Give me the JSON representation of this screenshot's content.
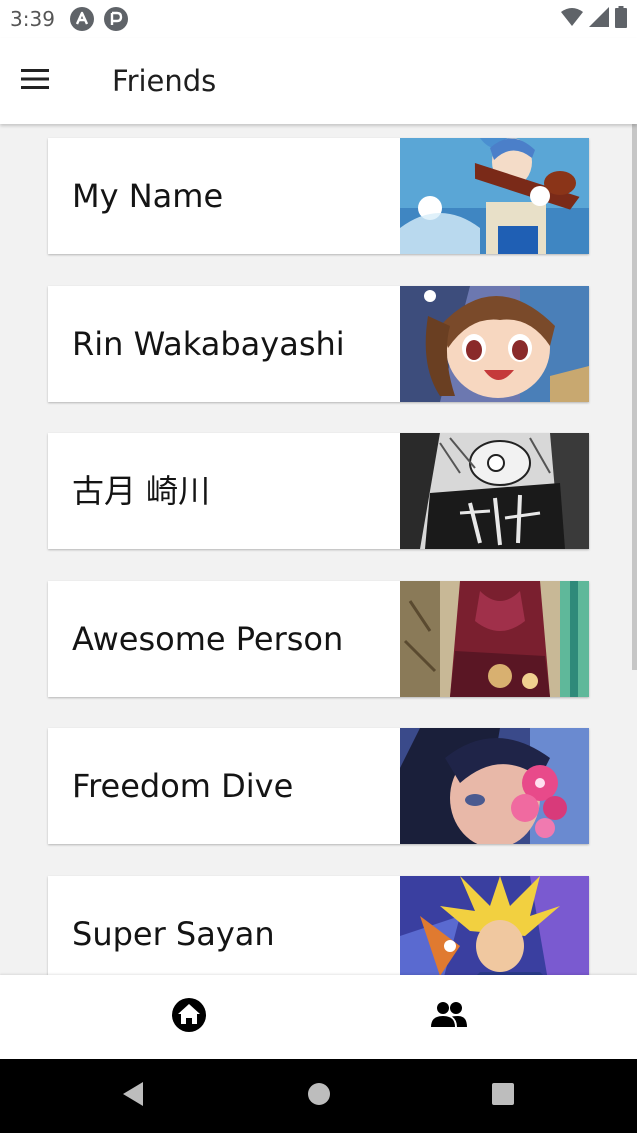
{
  "status_bar": {
    "time": "3:39",
    "left_icons": [
      "a-app-icon",
      "p-app-icon"
    ],
    "right_icons": [
      "wifi-icon",
      "signal-icon",
      "battery-icon"
    ]
  },
  "app_bar": {
    "menu_icon": "hamburger-menu-icon",
    "title": "Friends"
  },
  "friends": [
    {
      "name": "My Name",
      "avatar": "anime-violinist-art"
    },
    {
      "name": "Rin Wakabayashi",
      "avatar": "anime-girl-smiling-art"
    },
    {
      "name": "古月 崎川",
      "avatar": "manga-sketch-art"
    },
    {
      "name": "Awesome Person",
      "avatar": "kimono-figure-art"
    },
    {
      "name": "Freedom Dive",
      "avatar": "girl-with-flowers-art"
    },
    {
      "name": "Super Sayan",
      "avatar": "super-saiyan-art"
    }
  ],
  "bottom_nav": {
    "items": [
      {
        "icon": "home-icon"
      },
      {
        "icon": "people-icon"
      }
    ]
  },
  "system_nav": {
    "items": [
      "back-icon",
      "home-circle-icon",
      "recents-icon"
    ]
  },
  "colors": {
    "background": "#f2f2f2",
    "surface": "#ffffff",
    "text": "#141414",
    "system_nav": "#000000"
  }
}
